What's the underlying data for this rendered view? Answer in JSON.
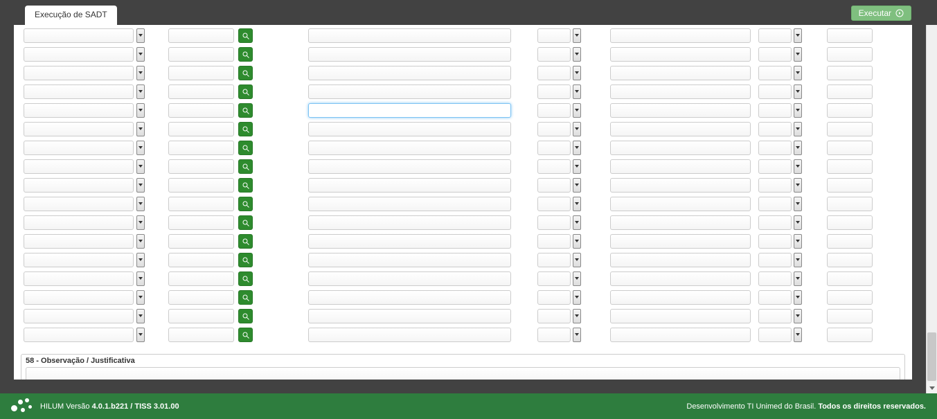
{
  "tab_title": "Execução de SADT",
  "exec_button": "Executar",
  "rows": 17,
  "active_row_index": 4,
  "observation": {
    "label": "58 - Observação / Justificativa",
    "value": ""
  },
  "footer": {
    "version_prefix": "HILUM Versão ",
    "version": "4.0.1.b221 / TISS 3.01.00",
    "credit_prefix": "Desenvolvimento TI Unimed do Brasil. ",
    "credit_bold": "Todos os direitos reservados."
  }
}
